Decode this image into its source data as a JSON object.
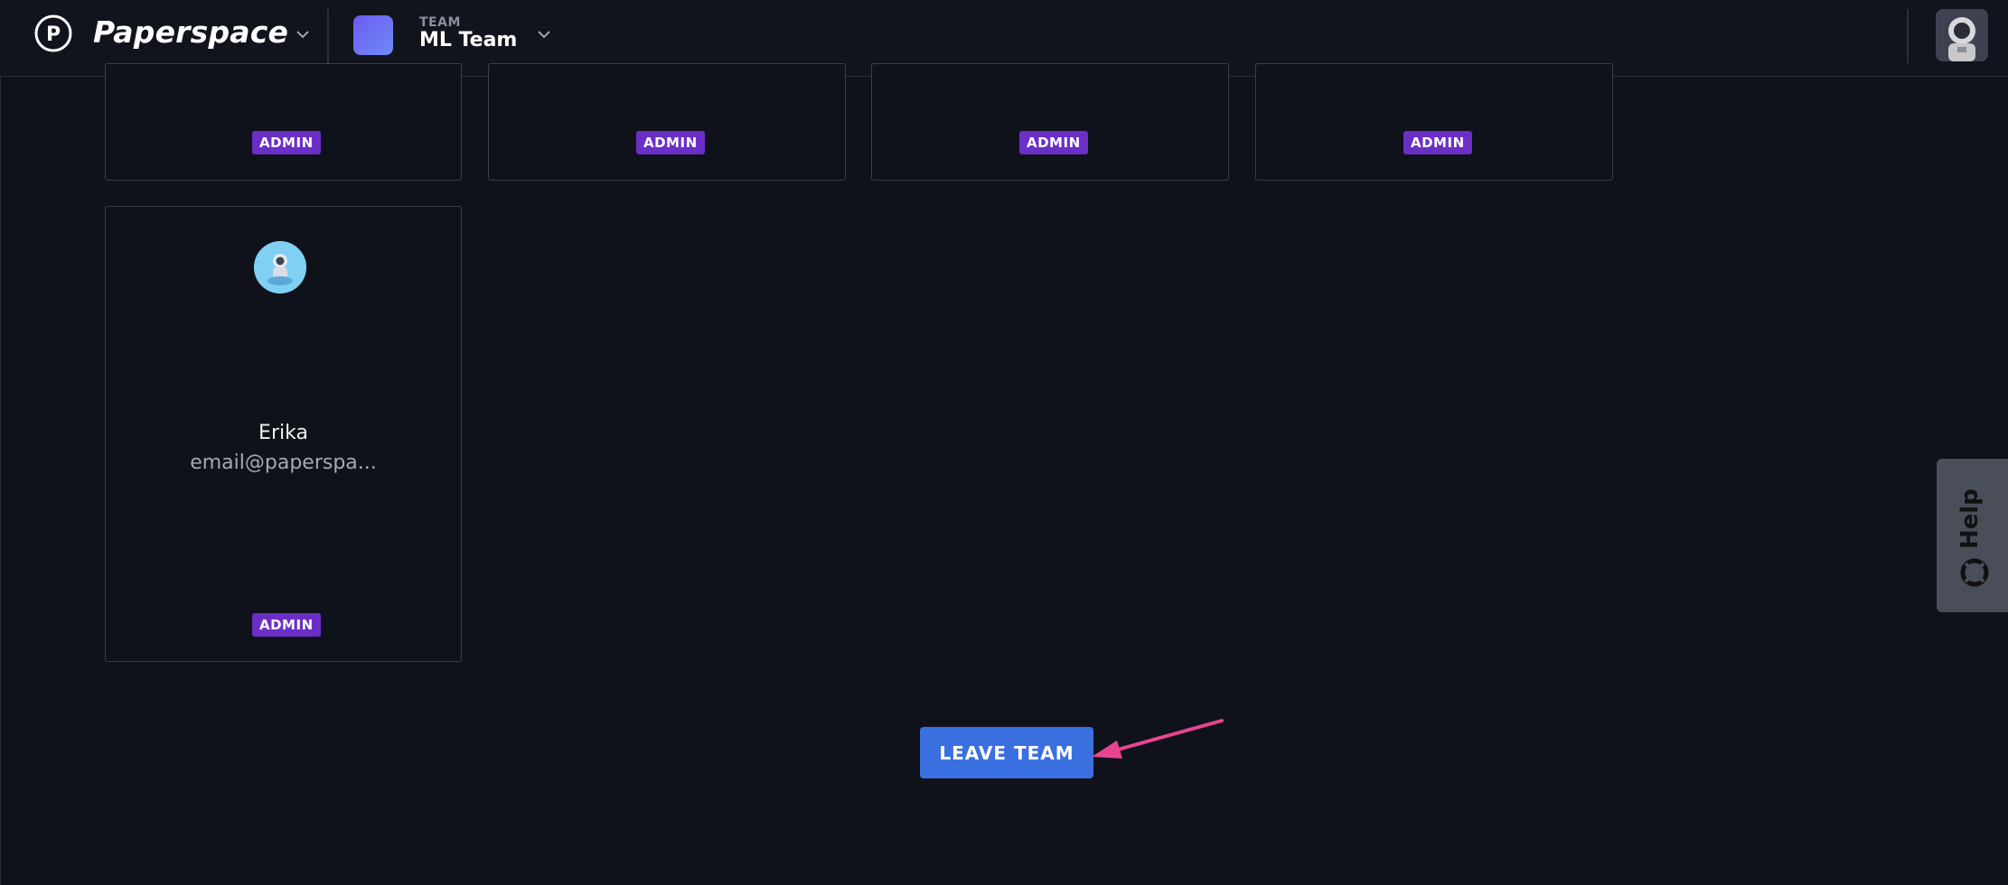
{
  "brand": {
    "name": "Paperspace",
    "logo_letter": "P"
  },
  "team": {
    "kicker": "TEAM",
    "name": "ML Team",
    "swatch_color": "#6c6ff2"
  },
  "members": {
    "top_row_badges": [
      "ADMIN",
      "ADMIN",
      "ADMIN",
      "ADMIN"
    ],
    "card": {
      "name": "Erika",
      "email": "email@paperspa...",
      "role": "ADMIN"
    }
  },
  "actions": {
    "leave_team_label": "LEAVE TEAM"
  },
  "help": {
    "label": "Help"
  },
  "colors": {
    "background": "#0f121a",
    "admin_badge": "#6b2fc7",
    "primary_button": "#3a6fe0",
    "annotation_arrow": "#e8458f"
  },
  "icons": [
    "paperspace-logo-icon",
    "chevron-down-icon",
    "user-avatar-icon",
    "lifebuoy-icon",
    "annotation-arrow"
  ]
}
